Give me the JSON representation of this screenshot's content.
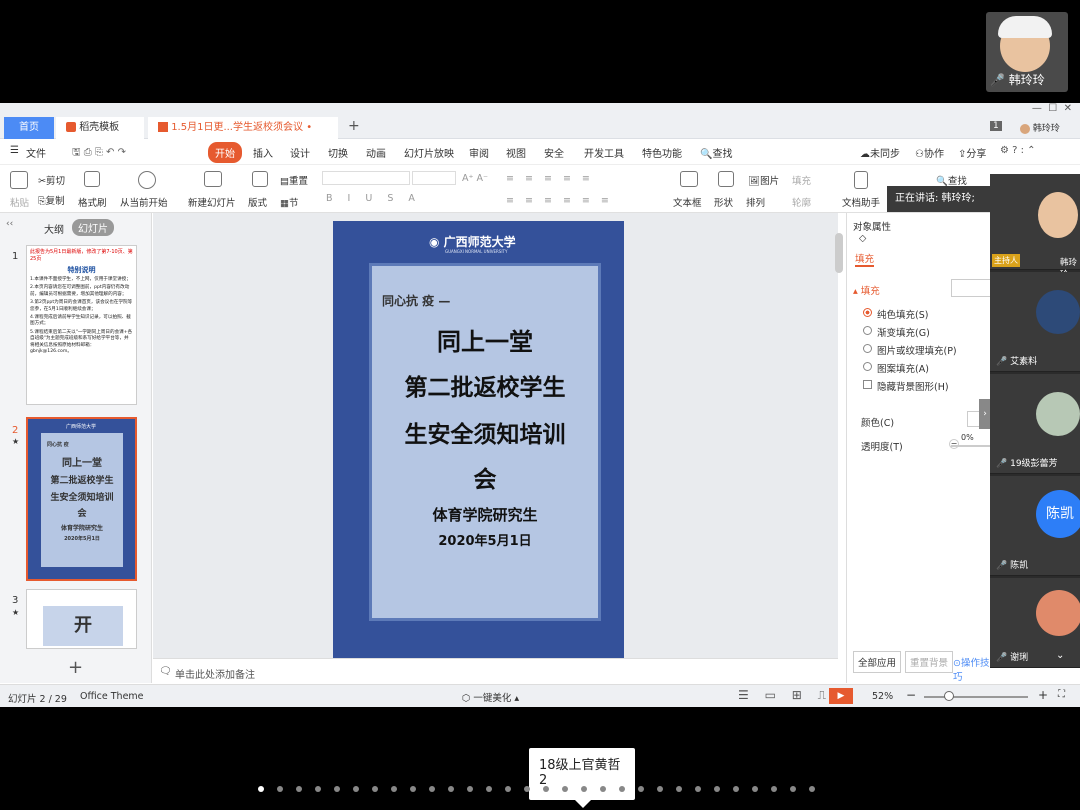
{
  "self_video": {
    "name": "韩玲玲"
  },
  "tabs": {
    "home": "首页",
    "templates": "稻壳模板",
    "doc": "1.5月1日更...学生返校须会议",
    "count_badge": "1",
    "user": "韩玲玲"
  },
  "menu": {
    "file": "文件",
    "start": "开始",
    "insert": "插入",
    "design": "设计",
    "switch": "切换",
    "animation": "动画",
    "slideshow": "幻灯片放映",
    "review": "审阅",
    "view": "视图",
    "security": "安全",
    "devtools": "开发工具",
    "special": "特色功能",
    "search": "查找",
    "unsynced": "未同步",
    "collab": "协作",
    "share": "分享"
  },
  "ribbon": {
    "paste": "粘贴",
    "cut": "剪切",
    "copy": "复制",
    "format_painter": "格式刷",
    "from_current": "从当前开始",
    "new_slide": "新建幻灯片",
    "layout": "版式",
    "reset": "重置",
    "section": "节",
    "textbox": "文本框",
    "shape": "形状",
    "arrange": "排列",
    "picture": "图片",
    "fill": "填充",
    "outline": "轮廓",
    "doc_helper": "文档助手",
    "find": "查找"
  },
  "left_panel": {
    "outline_tab": "大纲",
    "slides_tab": "幻灯片",
    "slide1": {
      "num": "1",
      "red": "此报告为5月1日最新版，修改了第7-10页、第25页",
      "title": "特别说明",
      "lines": [
        "1.本课件不面授学生，不上网，仅用于课堂讲授；",
        "2.本页内容请您在可调整图前，ppt内容仍有改动前，编辑员可根据需要，增加其他理解的内容；",
        "3.第2页ppt为周日的会课首页，该会议也在学院等您参，在5月1日顺利继续会课；",
        "4.课程完成后请前导学生知识记录，可以拍照、截图方式；",
        "5.课程结束后第二天以\"一学期同上周日的会课+各自班级\"为主题完成班级和系写好给学平台等，并将相关信息按照原始材料邮箱：gbnjk@126.com。"
      ]
    },
    "slide2": {
      "num": "2",
      "header": "同心抗 疫",
      "l1": "同上一堂",
      "l2": "第二批返校学生",
      "l3": "生安全须知培训",
      "l4": "会",
      "l5": "体育学院研究生",
      "l6": "2020年5月1日"
    },
    "slide3": {
      "num": "3",
      "text": "开"
    }
  },
  "slide": {
    "logo": "广西师范大学",
    "logo_sub": "GUANGXI NORMAL UNIVERSITY",
    "header": "同心抗 疫 —",
    "title1": "同上一堂",
    "title2": "第二批返校学生",
    "title3": "生安全须知培训",
    "title4": "会",
    "dept": "体育学院研究生",
    "date": "2020年5月1日"
  },
  "notes": {
    "placeholder": "单击此处添加备注"
  },
  "props": {
    "title": "对象属性",
    "fill_tab": "填充",
    "fill_section": "填充",
    "options": [
      "纯色填充(S)",
      "渐变填充(G)",
      "图片或纹理填充(P)",
      "图案填充(A)"
    ],
    "hide_bg": "隐藏背景图形(H)",
    "color": "颜色(C)",
    "transparency": "透明度(T)",
    "transparency_value": "0%",
    "apply_all": "全部应用",
    "reset_bg": "重置背景",
    "op_tips": "操作技巧"
  },
  "status": {
    "slide_count": "幻灯片 2 / 29",
    "theme": "Office Theme",
    "beautify": "一键美化",
    "zoom": "52%"
  },
  "speaking": "正在讲话: 韩玲玲;",
  "participants": [
    {
      "name": "韩玲玲",
      "badge": "主持人"
    },
    {
      "name": "艾素料"
    },
    {
      "name": "19级彭蕾芳"
    },
    {
      "name": "陈凯",
      "avatar_text": "陈凯"
    },
    {
      "name": "陈凯"
    },
    {
      "name": "谢琍"
    }
  ],
  "tooltip": {
    "name": "18级上官黄哲",
    "count": "2"
  },
  "colors": {
    "accent": "#e65a2f",
    "slide_bg": "#34519a",
    "slide_inner": "#b5c6e3",
    "home_tab": "#4c8bf5"
  }
}
